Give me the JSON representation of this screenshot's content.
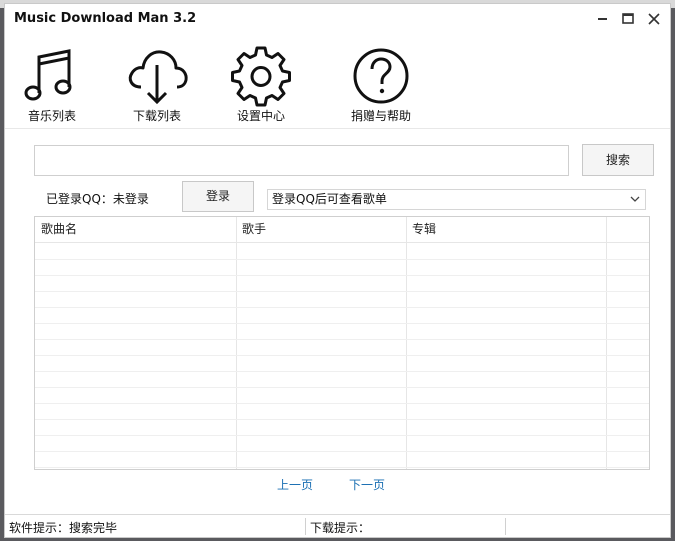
{
  "window": {
    "title": "Music Download Man 3.2"
  },
  "toolbar": {
    "items": [
      {
        "label": "音乐列表",
        "icon": "music-note-icon"
      },
      {
        "label": "下载列表",
        "icon": "cloud-download-icon"
      },
      {
        "label": "设置中心",
        "icon": "gear-icon"
      },
      {
        "label": "捐赠与帮助",
        "icon": "help-icon"
      }
    ]
  },
  "search": {
    "value": "",
    "button_label": "搜索"
  },
  "login": {
    "status_label": "已登录QQ：未登录",
    "button_label": "登录",
    "playlist_select_value": "登录QQ后可查看歌单"
  },
  "table": {
    "columns": [
      "歌曲名",
      "歌手",
      "专辑",
      ""
    ],
    "rows": []
  },
  "pager": {
    "prev_label": "上一页",
    "next_label": "下一页"
  },
  "status": {
    "software_tip": "软件提示：搜索完毕",
    "download_tip": "下载提示："
  },
  "colors": {
    "accent_link": "#1a6fb3",
    "border": "#cfcfcf"
  }
}
